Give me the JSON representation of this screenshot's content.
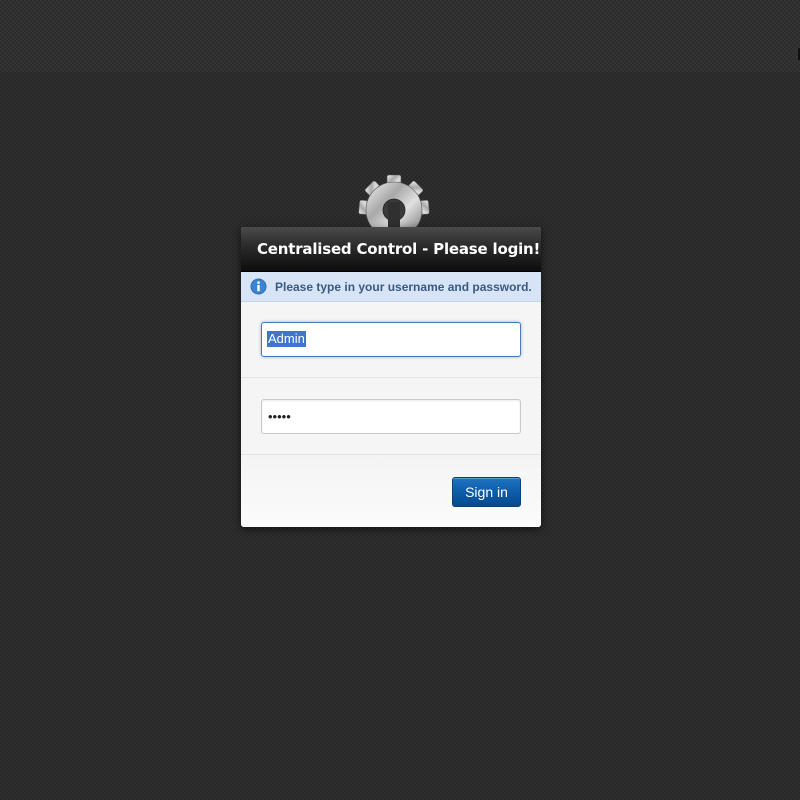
{
  "login": {
    "title": "Centralised Control - Please login!",
    "info_message": "Please type in your username and password.",
    "username": {
      "value": "Admin"
    },
    "password": {
      "value": "•••••"
    },
    "signin_label": "Sign in"
  },
  "icons": {
    "logo": "gear-logo-icon",
    "info": "info-icon"
  },
  "colors": {
    "accent": "#0c5aa6",
    "info_background": "#d6e4f5",
    "info_text": "#3a5a84",
    "header_background": "#1a1a1a",
    "page_background": "#2f2f2f"
  }
}
